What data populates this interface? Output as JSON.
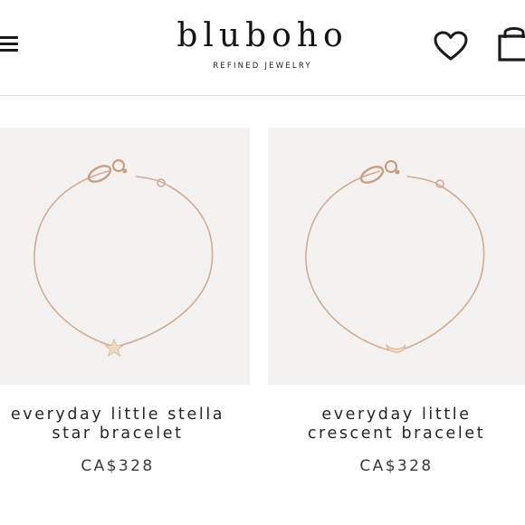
{
  "header": {
    "brand": "bluboho",
    "tagline": "REFINED JEWELRY",
    "icons": {
      "menu": "hamburger-menu-icon",
      "wishlist": "heart-icon",
      "bag": "shopping-bag-icon"
    }
  },
  "products": [
    {
      "name_line1": "everyday little stella",
      "name_line2": "star bracelet",
      "price": "CA$328",
      "charm": "star"
    },
    {
      "name_line1": "everyday little",
      "name_line2": "crescent bracelet",
      "price": "CA$328",
      "charm": "crescent"
    }
  ],
  "colors": {
    "image_bg": "#f4f2f0",
    "chain": "#d8b39c",
    "text": "#262626"
  }
}
